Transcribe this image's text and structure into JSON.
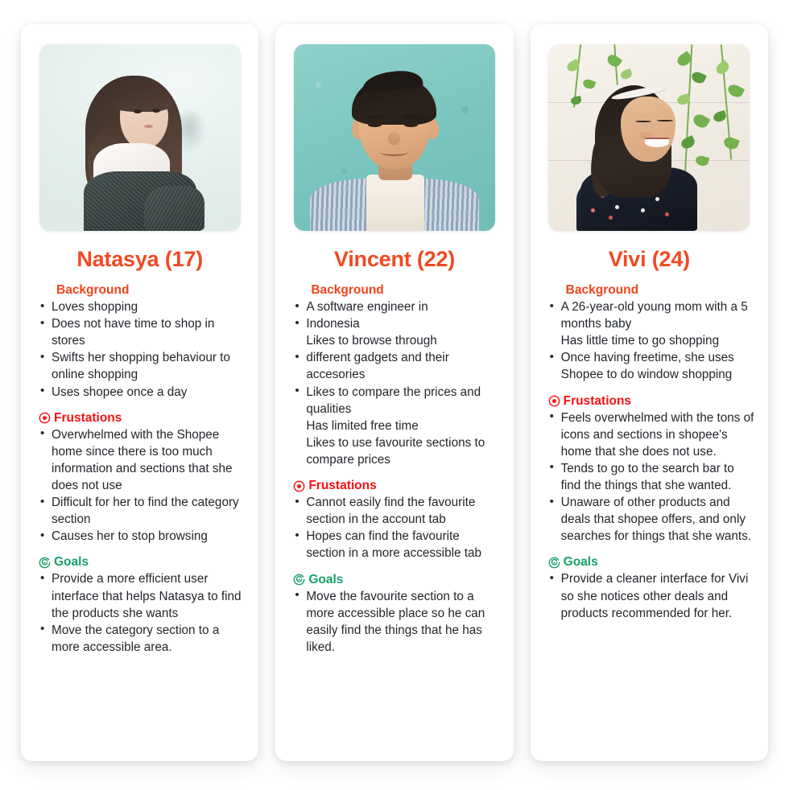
{
  "colors": {
    "name_orange": "#f04a23",
    "background_heading": "#f0431c",
    "frustations_red": "#fa0f11",
    "goals_green": "#17a067",
    "body_text": "#22262b",
    "card_bg": "#ffffff",
    "page_bg": "#ffffff"
  },
  "section_labels": {
    "background": "Background",
    "frustations": "Frustations",
    "goals": "Goals"
  },
  "icons": {
    "frustations": "bullseye-icon",
    "goals": "target-spiral-icon"
  },
  "personas": [
    {
      "name": "Natasya (17)",
      "photo_alt": "young woman looking over shoulder against pale mint wall",
      "background": [
        {
          "text": "Loves shopping",
          "cont": false
        },
        {
          "text": "Does not have time to shop in stores",
          "cont": false
        },
        {
          "text": "Swifts her shopping behaviour to online shopping",
          "cont": false
        },
        {
          "text": "Uses shopee once a day",
          "cont": false
        }
      ],
      "frustations": [
        {
          "text": "Overwhelmed with the Shopee home since there is too much information and sections that she does not use",
          "cont": false
        },
        {
          "text": "Difficult for her to find the category section",
          "cont": false
        },
        {
          "text": "Causes her to stop browsing",
          "cont": false
        }
      ],
      "goals": [
        {
          "text": "Provide a more efficient user interface that helps Natasya to find the products she wants",
          "cont": false
        },
        {
          "text": "Move the category section to a more accessible area.",
          "cont": false
        }
      ]
    },
    {
      "name": "Vincent (22)",
      "photo_alt": "young man smiling against teal wall wearing striped shirt",
      "background": [
        {
          "text": "A software engineer in",
          "cont": false
        },
        {
          "text": "Indonesia",
          "cont": false
        },
        {
          "text": "Likes to browse through",
          "cont": true
        },
        {
          "text": "different gadgets and their accesories",
          "cont": false
        },
        {
          "text": "Likes to compare the prices and qualities",
          "cont": false
        },
        {
          "text": "Has limited free time",
          "cont": true
        },
        {
          "text": "Likes to use favourite sections to compare prices",
          "cont": true
        }
      ],
      "frustations": [
        {
          "text": "Cannot easily find the favourite section in the account tab",
          "cont": false
        },
        {
          "text": "Hopes can find the favourite section in a more accessible tab",
          "cont": false
        }
      ],
      "goals": [
        {
          "text": "Move the favourite section to a more accessible place so he can easily find the things that he has liked.",
          "cont": false
        }
      ]
    },
    {
      "name": "Vivi (24)",
      "photo_alt": "smiling woman in floral dress with vines on cream wall",
      "background": [
        {
          "text": "A 26-year-old young mom with a 5 months baby",
          "cont": false
        },
        {
          "text": "Has little time to go shopping",
          "cont": true
        },
        {
          "text": "Once having freetime, she uses Shopee to do window shopping",
          "cont": false
        }
      ],
      "frustations": [
        {
          "text": "Feels overwhelmed with the tons of icons and sections in shopee's home that she does not use.",
          "cont": false
        },
        {
          "text": "Tends to go to the search bar to find the things that she wanted.",
          "cont": false
        },
        {
          "text": "Unaware of other products and deals that shopee offers, and only searches for things that she wants.",
          "cont": false
        }
      ],
      "goals": [
        {
          "text": "Provide a cleaner interface for Vivi so she notices other deals and products recommended for her.",
          "cont": false
        }
      ]
    }
  ]
}
